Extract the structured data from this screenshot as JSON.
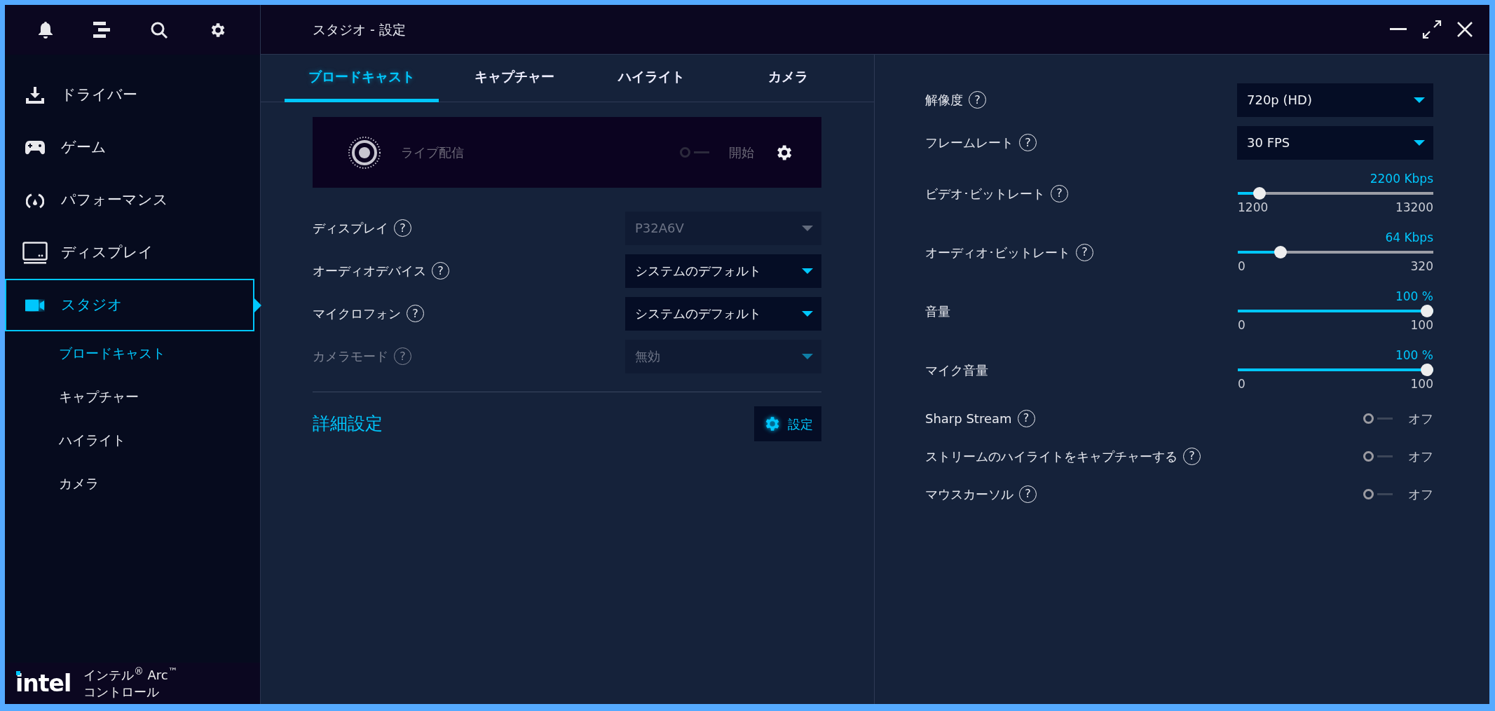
{
  "window": {
    "title": "スタジオ - 設定"
  },
  "sidebar": {
    "items": [
      {
        "label": "ドライバー",
        "kind": "download",
        "selected": false
      },
      {
        "label": "ゲーム",
        "kind": "gamepad",
        "selected": false
      },
      {
        "label": "パフォーマンス",
        "kind": "gauge",
        "selected": false
      },
      {
        "label": "ディスプレイ",
        "kind": "monitor",
        "selected": false
      },
      {
        "label": "スタジオ",
        "kind": "camera",
        "selected": true,
        "children": [
          {
            "label": "ブロードキャスト",
            "selected": true
          },
          {
            "label": "キャプチャー",
            "selected": false
          },
          {
            "label": "ハイライト",
            "selected": false
          },
          {
            "label": "カメラ",
            "selected": false
          }
        ]
      }
    ]
  },
  "brand": {
    "logo": "intel",
    "title": "インテル$^{®}$ Arc$^{™}$",
    "subtitle": "コントロール"
  },
  "tabs": [
    {
      "label": "ブロードキャスト",
      "selected": true
    },
    {
      "label": "キャプチャー",
      "selected": false
    },
    {
      "label": "ハイライト",
      "selected": false
    },
    {
      "label": "カメラ",
      "selected": false
    }
  ],
  "live": {
    "label": "ライブ配信",
    "on": false,
    "action": "開始",
    "disabled": true
  },
  "fields": [
    {
      "label": "ディスプレイ",
      "help": "?",
      "value": "P32A6V",
      "disabled": true,
      "label_disabled": false
    },
    {
      "label": "オーディオデバイス",
      "help": "?",
      "value": "システムのデフォルト",
      "disabled": false,
      "label_disabled": false
    },
    {
      "label": "マイクロフォン",
      "help": "?",
      "value": "システムのデフォルト",
      "disabled": false,
      "label_disabled": false
    },
    {
      "label": "カメラモード",
      "help": "?",
      "value": "無効",
      "disabled": true,
      "label_disabled": true
    }
  ],
  "advanced": {
    "label": "詳細設定",
    "button": "設定"
  },
  "settings": [
    {
      "kind": "select",
      "label": "解像度",
      "help": "?",
      "value": "720p (HD)"
    },
    {
      "kind": "select",
      "label": "フレームレート",
      "help": "?",
      "value": "30 FPS"
    },
    {
      "kind": "slider",
      "label": "ビデオ･ビットレート",
      "help": "?",
      "reading": "2200 Kbps",
      "min": "1200",
      "max": "13200",
      "level": 0.083
    },
    {
      "kind": "slider",
      "label": "オーディオ･ビットレート",
      "help": "?",
      "reading": "64 Kbps",
      "min": "0",
      "max": "320",
      "level": 0.2
    },
    {
      "kind": "slider",
      "label": "音量",
      "reading": "100 %",
      "min": "0",
      "max": "100",
      "level": 1
    },
    {
      "kind": "slider",
      "label": "マイク音量",
      "reading": "100 %",
      "min": "0",
      "max": "100",
      "level": 1
    },
    {
      "kind": "toggle",
      "label": "Sharp Stream",
      "help": "?",
      "on": false,
      "state": "オフ"
    },
    {
      "kind": "toggle",
      "label": "ストリームのハイライトをキャプチャーする",
      "help": "?",
      "on": false,
      "state": "オフ"
    },
    {
      "kind": "toggle",
      "label": "マウスカーソル",
      "help": "?",
      "on": false,
      "state": "オフ"
    }
  ]
}
